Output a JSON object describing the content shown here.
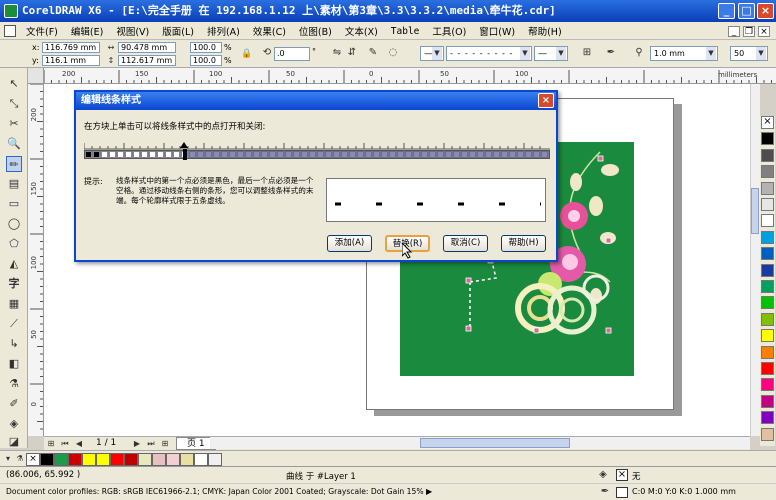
{
  "window": {
    "title": "CorelDRAW X6 - [E:\\完全手册 在 192.168.1.12 上\\素材\\第3章\\3.3\\3.3.2\\media\\牵牛花.cdr]",
    "minimize": "_",
    "maximize": "□",
    "close": "×"
  },
  "menu": {
    "items": [
      "文件(F)",
      "编辑(E)",
      "视图(V)",
      "版面(L)",
      "排列(A)",
      "效果(C)",
      "位图(B)",
      "文本(X)",
      "Table",
      "工具(O)",
      "窗口(W)",
      "帮助(H)"
    ],
    "mdi_min": "_",
    "mdi_restore": "❐",
    "mdi_close": "×"
  },
  "propbar": {
    "x_label": "x:",
    "x_value": "116.769 mm",
    "y_label": "y:",
    "y_value": "116.1 mm",
    "w_value": "90.478 mm",
    "h_value": "112.617 mm",
    "scale_x": "100.0",
    "scale_y": "100.0",
    "pct": "%",
    "rotation": ".0",
    "degree": "°",
    "outline_width": "1.0 mm",
    "zoom_value": "50"
  },
  "rulers": {
    "h_ticks": [
      "200",
      "150",
      "100",
      "50",
      "0",
      "50",
      "100"
    ],
    "unit": "millimeters",
    "v_ticks": [
      "200",
      "150",
      "100",
      "50",
      "0",
      "50"
    ]
  },
  "dialog": {
    "title": "编辑线条样式",
    "instruction": "在方块上单击可以将线条样式中的点打开和关闭:",
    "hint_label": "提示:",
    "hint_text": "线条样式中的第一个点必须是黑色，最后一个点必须是一个空格。通过移动线条右侧的条形，您可以调整线条样式的末端。每个轮廓样式限于五条虚线。",
    "buttons": [
      "添加(A)",
      "替换(R)",
      "取消(C)",
      "帮助(H)"
    ]
  },
  "docnav": {
    "page_counter": "1 / 1",
    "page_tab": "页 1"
  },
  "status": {
    "coords": "(86.006, 65.992 )",
    "selection": "曲线 于 #Layer 1",
    "profiles": "Document color profiles: RGB: sRGB IEC61966-2.1; CMYK: Japan Color 2001 Coated; Grayscale: Dot Gain 15%",
    "fill_none": "无",
    "outline_info": "C:0 M:0 Y:0 K:0  1.000 mm"
  },
  "palette_colors": [
    "#ffffff",
    "#000000",
    "#4d4d4d",
    "#808080",
    "#b3b3b3",
    "#e6e6e6",
    "#ffffff",
    "#00a0e0",
    "#0060c0",
    "#1a3a9e",
    "#00a060",
    "#00c000",
    "#80c000",
    "#ffff00",
    "#ff8000",
    "#ff0000",
    "#ff0080",
    "#c00080",
    "#8000c0",
    "#e0c0a0"
  ],
  "bottom_colors": [
    "#000000",
    "#1a9c4a",
    "#cc0000",
    "#ffff00",
    "#ffff00",
    "#ff0000",
    "#c00000",
    "#e8e8c0",
    "#e8c0c0",
    "#f0d0d0",
    "#e8e0a0",
    "#ffffff",
    "#f0f0f0"
  ]
}
